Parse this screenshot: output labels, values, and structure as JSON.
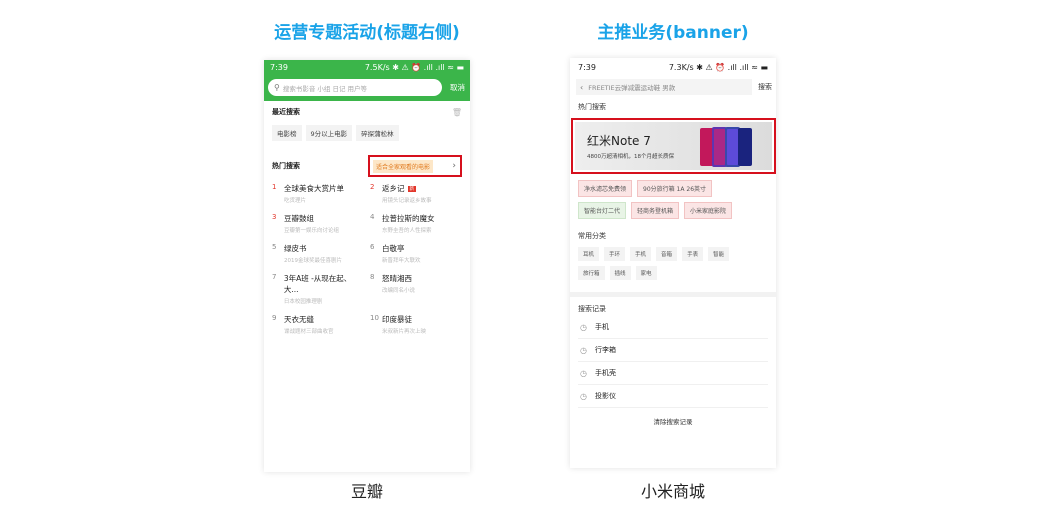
{
  "sections": {
    "left_title": "运营专题活动(标题右侧)",
    "right_title": "主推业务(banner)",
    "left_caption": "豆瓣",
    "right_caption": "小米商城"
  },
  "douban": {
    "status": {
      "time": "7:39",
      "right": "7.5K/s ✱ ⚠ ⏰ .ıll .ıll ≈ ▬"
    },
    "search_placeholder": "搜索书影音 小组 日记 用户等",
    "cancel": "取消",
    "recent_label": "最近搜索",
    "recent_items": [
      "电影榜",
      "9分以上电影",
      "碎探蒲松林"
    ],
    "hot_label": "热门搜索",
    "hot_tag": "适合全家观看的电影",
    "hot_items": [
      {
        "num": "1",
        "title": "全球美食大赏片单",
        "sub": "吃货理片",
        "red": true,
        "badge": ""
      },
      {
        "num": "2",
        "title": "返乡记",
        "sub": "用镜头记录返乡故事",
        "red": true,
        "badge": "新"
      },
      {
        "num": "3",
        "title": "豆瓣鼓组",
        "sub": "豆瓣第一娱乐向讨论组",
        "red": true,
        "badge": ""
      },
      {
        "num": "4",
        "title": "拉普拉斯的魔女",
        "sub": "东野圭吾的人性探索",
        "red": false,
        "badge": ""
      },
      {
        "num": "5",
        "title": "绿皮书",
        "sub": "2019金球奖最佳喜剧片",
        "red": false,
        "badge": ""
      },
      {
        "num": "6",
        "title": "白敬亭",
        "sub": "新晋拜年大联欢",
        "red": false,
        "badge": ""
      },
      {
        "num": "7",
        "title": "3年A班 -从现在起、大...",
        "sub": "日本校园推理剧",
        "red": false,
        "badge": ""
      },
      {
        "num": "8",
        "title": "怒晴湘西",
        "sub": "改编同名小说",
        "red": false,
        "badge": ""
      },
      {
        "num": "9",
        "title": "天衣无缝",
        "sub": "谍战题材三部曲收官",
        "red": false,
        "badge": ""
      },
      {
        "num": "10",
        "title": "印度暴徒",
        "sub": "米叔新片再次上映",
        "red": false,
        "badge": ""
      }
    ]
  },
  "xiaomi": {
    "status": {
      "time": "7:39",
      "right": "7.3K/s ✱ ⚠ ⏰ .ıll .ıll ≈ ▬"
    },
    "search_placeholder": "FREETIE云弹减震运动鞋 男款",
    "search_button": "搜索",
    "hot_label": "热门搜索",
    "banner_title": "红米Note 7",
    "banner_sub": "4800万超清相机，18个月超长质保",
    "tag_row1": [
      "净水滤芯免费领",
      "90分旅行箱 1A 26英寸"
    ],
    "tag_row2": [
      "智能台灯二代",
      "轻商务登机箱",
      "小米家庭影院"
    ],
    "cat_label": "常用分类",
    "categories": [
      "耳机",
      "手环",
      "手机",
      "音箱",
      "手表",
      "智能",
      "旅行箱",
      "插线",
      "家电"
    ],
    "history_label": "搜索记录",
    "history": [
      "手机",
      "行李箱",
      "手机壳",
      "投影仪"
    ],
    "clear": "清除搜索记录"
  }
}
